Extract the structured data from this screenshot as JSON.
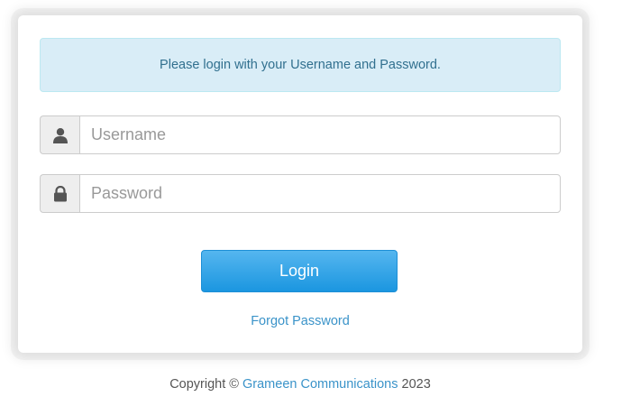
{
  "notice": {
    "message": "Please login with your Username and Password."
  },
  "form": {
    "username_placeholder": "Username",
    "username_value": "",
    "password_placeholder": "Password",
    "password_value": "",
    "login_label": "Login",
    "forgot_label": "Forgot Password"
  },
  "icons": {
    "username": "user-icon",
    "password": "lock-icon"
  },
  "footer": {
    "prefix": "Copyright ©",
    "company": "Grameen Communications",
    "year": "2023"
  },
  "colors": {
    "notice_bg": "#d9edf7",
    "notice_text": "#31708f",
    "button": "#1b96e0",
    "link": "#3a93c9"
  }
}
